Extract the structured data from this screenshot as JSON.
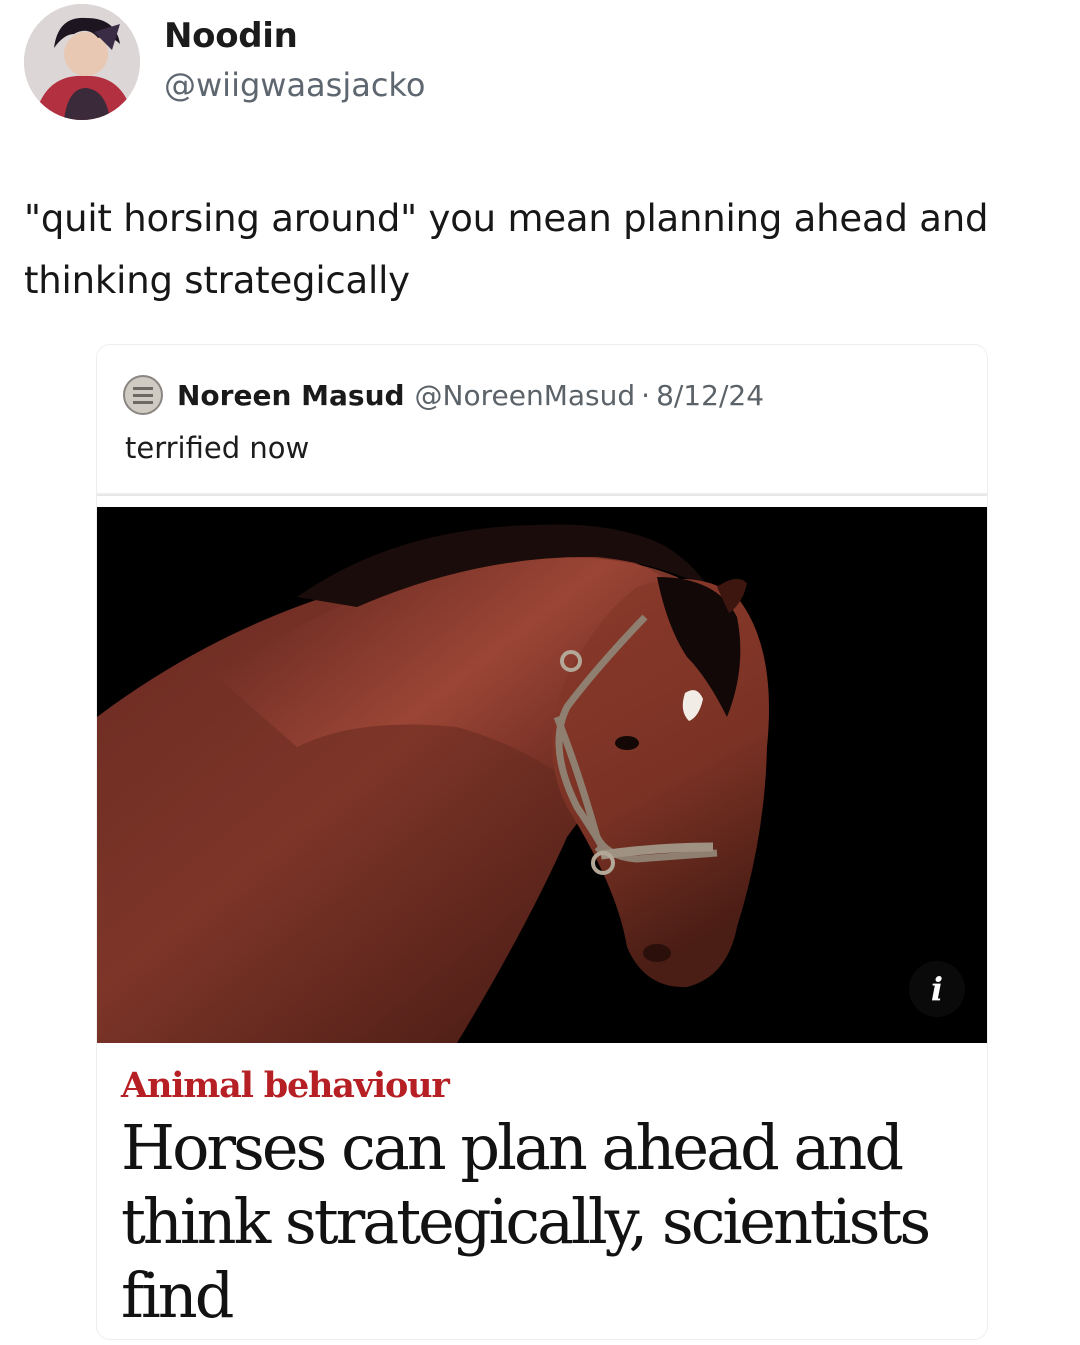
{
  "tweet": {
    "display_name": "Noodin",
    "handle": "@wiigwaasjacko",
    "text": "\"quit horsing around\" you mean planning ahead and thinking strategically"
  },
  "quoted_tweet": {
    "display_name": "Noreen Masud",
    "handle": "@NoreenMasud",
    "separator": "·",
    "date": "8/12/24",
    "text": "terrified now"
  },
  "article": {
    "kicker": "Animal behaviour",
    "headline": "Horses can plan ahead and think strategically, scientists find",
    "info_label": "i",
    "info_icon": "info-icon",
    "image_subject": "horse-photo"
  },
  "colors": {
    "kicker": "#b61f24",
    "handle": "#5e6670",
    "image_background": "#000000"
  }
}
